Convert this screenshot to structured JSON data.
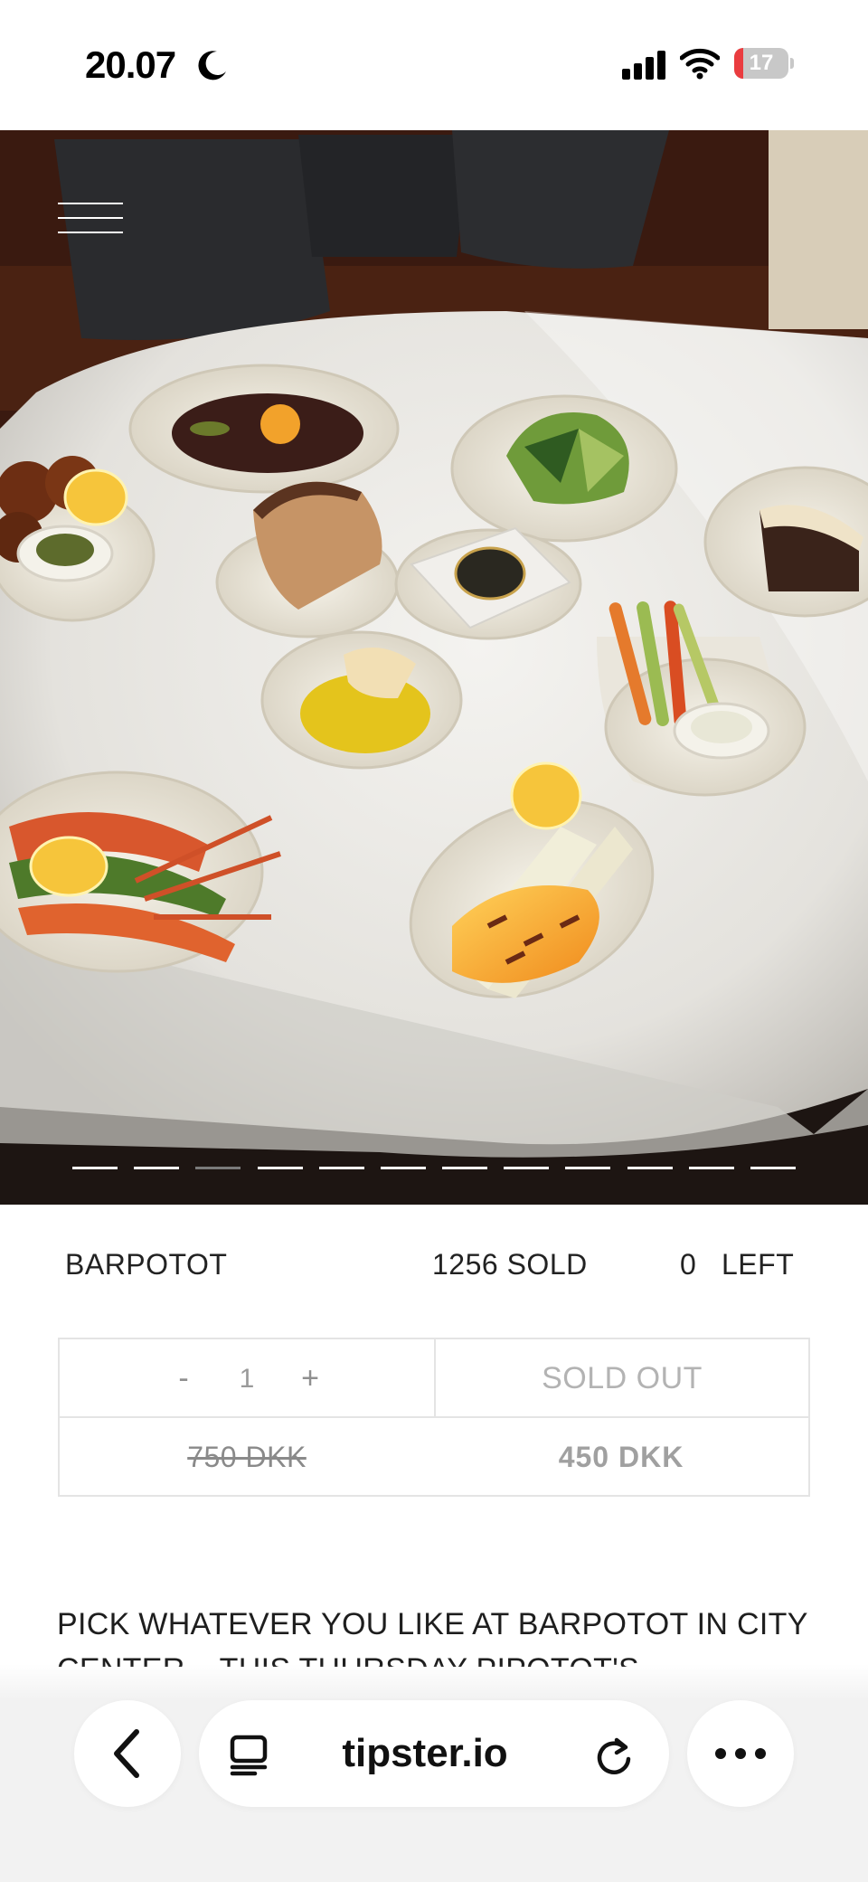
{
  "status_bar": {
    "time": "20.07",
    "battery": "17",
    "battery_level": 0.17,
    "icons": [
      "moon-icon",
      "signal-icon",
      "wifi-icon",
      "battery-icon"
    ]
  },
  "hero": {
    "image_subject": "restaurant table with assorted dishes",
    "carousel_count": 12,
    "carousel_active_index": 2
  },
  "product": {
    "name": "BARPOTOT",
    "sold": "1256 SOLD",
    "left_count": "0",
    "left_label": "LEFT",
    "quantity_minus": "-",
    "quantity": "1",
    "quantity_plus": "+",
    "status": "SOLD OUT",
    "old_price": "750 DKK",
    "price": "450 DKK"
  },
  "description": "PICK WHATEVER YOU LIKE AT BARPOTOT IN CITY CENTER – THIS THURSDAY PIPOTOT'S",
  "browser": {
    "url": "tipster.io",
    "icons": [
      "back-icon",
      "tabs-icon",
      "reload-icon",
      "more-icon"
    ]
  },
  "colors": {
    "accent_battery": "#ea3c3f",
    "border": "#e4e4e4",
    "muted_text": "#a0a0a0"
  }
}
